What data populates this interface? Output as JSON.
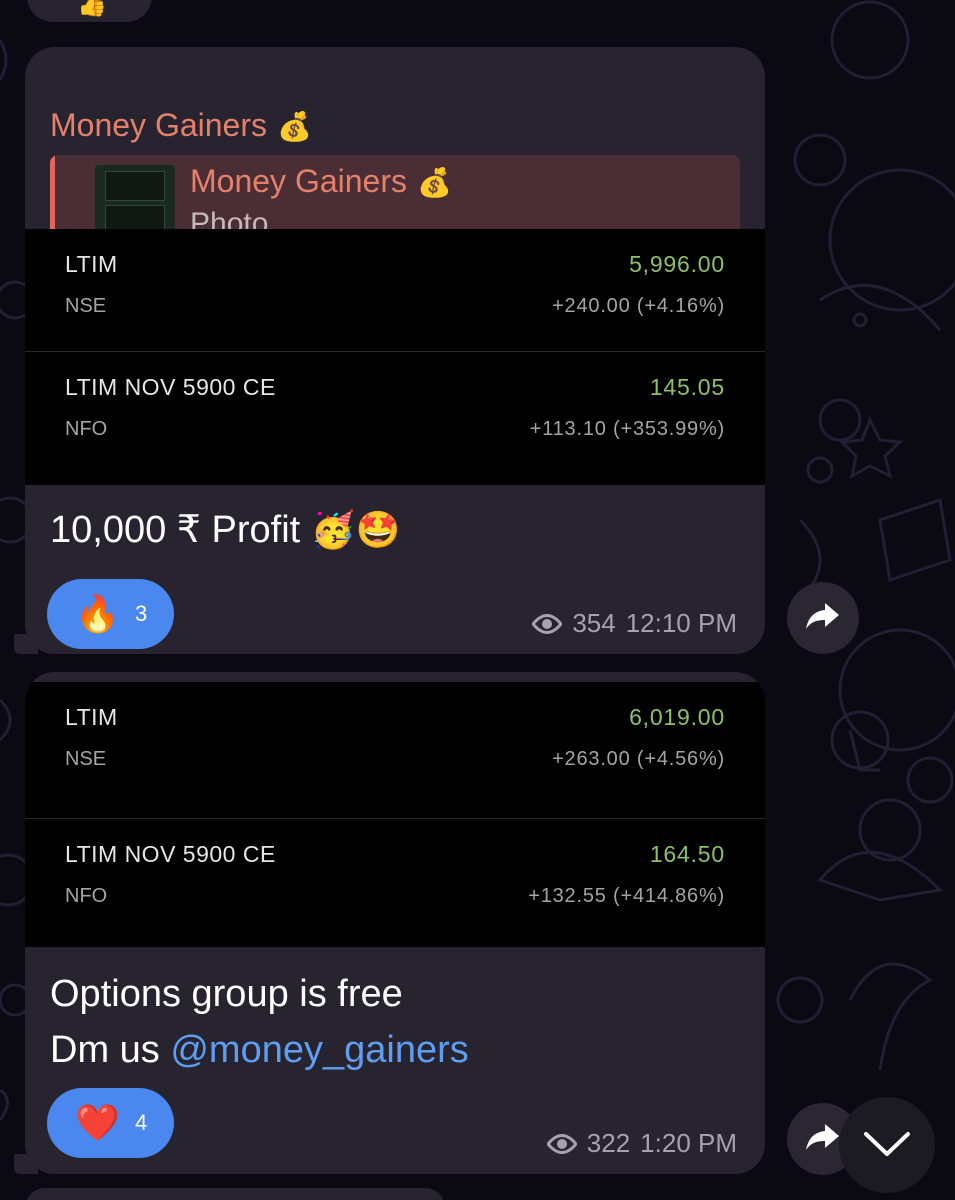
{
  "previous_message": {
    "reaction_emoji": "👍"
  },
  "messages": [
    {
      "sender": "Money Gainers",
      "sender_emoji": "💰",
      "reply": {
        "name": "Money Gainers",
        "emoji": "💰",
        "label": "Photo"
      },
      "stocks": [
        {
          "symbol": "LTIM",
          "exchange": "NSE",
          "price": "5,996.00",
          "change": "+240.00 (+4.16%)"
        },
        {
          "symbol": "LTIM NOV 5900 CE",
          "exchange": "NFO",
          "price": "145.05",
          "change": "+113.10 (+353.99%)"
        }
      ],
      "text": "10,000 ₹ Profit ",
      "text_emojis": "🥳🤩",
      "reaction": {
        "emoji": "🔥",
        "count": "3"
      },
      "views": "354",
      "time": "12:10 PM"
    },
    {
      "stocks": [
        {
          "symbol": "LTIM",
          "exchange": "NSE",
          "price": "6,019.00",
          "change": "+263.00 (+4.56%)"
        },
        {
          "symbol": "LTIM NOV 5900 CE",
          "exchange": "NFO",
          "price": "164.50",
          "change": "+132.55 (+414.86%)"
        }
      ],
      "text_line1": "Options group is free",
      "text_line2_prefix": "Dm us ",
      "text_line2_link": "@money_gainers",
      "reaction": {
        "emoji": "❤️",
        "count": "4"
      },
      "views": "322",
      "time": "1:20 PM"
    }
  ],
  "colors": {
    "background": "#0b0a12",
    "bubble": "#27232f",
    "sender": "#e5816b",
    "reaction": "#4a87ef",
    "price_up": "#8cc06d",
    "link": "#5e9df0"
  },
  "icons": [
    "eye-icon",
    "share-icon",
    "chevron-down-icon"
  ]
}
